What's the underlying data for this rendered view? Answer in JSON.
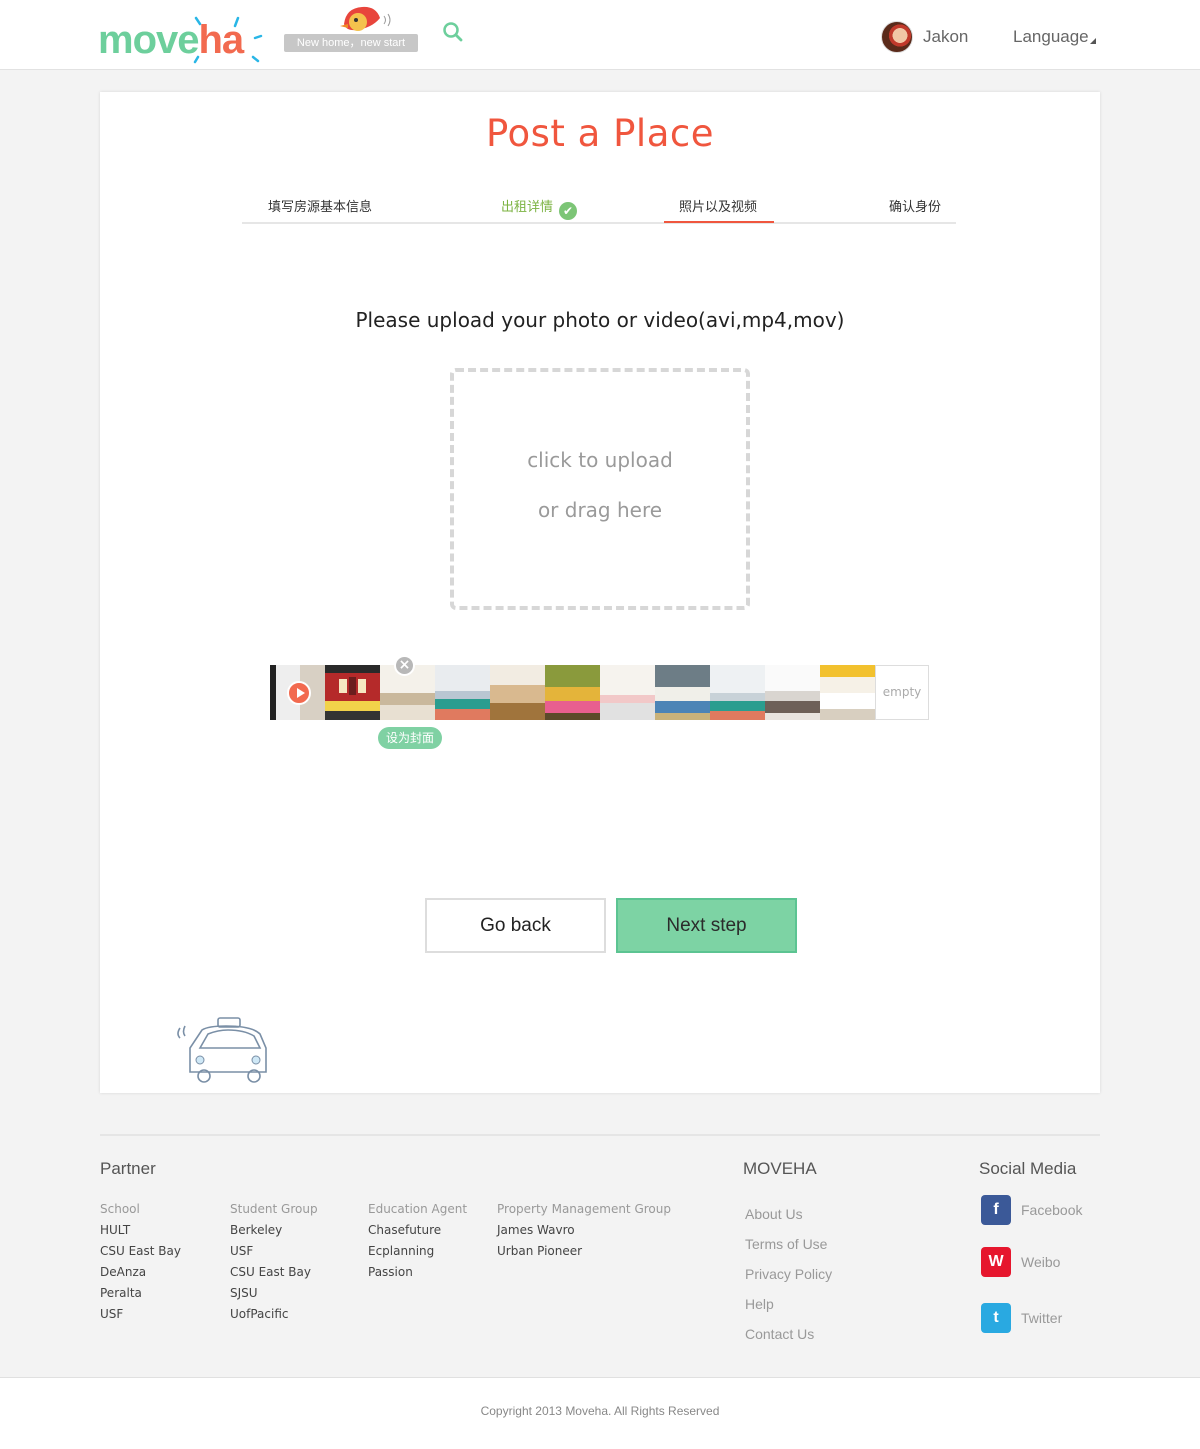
{
  "header": {
    "logo": {
      "part1": "move",
      "part2": "ha"
    },
    "tagline": "New home，new start",
    "user_name": "Jakon",
    "language_label": "Language"
  },
  "main": {
    "title": "Post  a Place",
    "steps": [
      {
        "label": "填写房源基本信息",
        "state": "pending"
      },
      {
        "label": "出租详情",
        "state": "done"
      },
      {
        "label": "照片以及视频",
        "state": "active"
      },
      {
        "label": "确认身份",
        "state": "pending"
      }
    ],
    "upload_prompt": "Please upload your photo or video(avi,mp4,mov)",
    "dropzone": {
      "line1": "click to upload",
      "line2": "or drag here"
    },
    "thumbnails": {
      "items": [
        {
          "kind": "video"
        },
        {
          "kind": "photo"
        },
        {
          "kind": "photo"
        },
        {
          "kind": "photo"
        },
        {
          "kind": "photo"
        },
        {
          "kind": "photo"
        },
        {
          "kind": "photo"
        },
        {
          "kind": "photo"
        },
        {
          "kind": "photo"
        },
        {
          "kind": "photo"
        },
        {
          "kind": "photo"
        }
      ],
      "empty_label": "empty",
      "set_cover_label": "设为封面",
      "remove_symbol": "×"
    },
    "buttons": {
      "back": "Go back",
      "next": "Next  step"
    }
  },
  "footer": {
    "partner_heading": "Partner",
    "partner_columns": [
      {
        "caption": "School",
        "items": [
          "HULT",
          "CSU East Bay",
          "DeAnza",
          "Peralta",
          "USF"
        ]
      },
      {
        "caption": "Student Group",
        "items": [
          "Berkeley",
          "USF",
          "CSU East Bay",
          "SJSU",
          "UofPacific"
        ]
      },
      {
        "caption": "Education Agent",
        "items": [
          "Chasefuture",
          "Ecplanning",
          "Passion"
        ]
      },
      {
        "caption": "Property Management Group",
        "items": [
          "James Wavro",
          "Urban Pioneer"
        ]
      }
    ],
    "moveha_heading": "MOVEHA",
    "moveha_links": [
      "About Us",
      "Terms of Use",
      "Privacy Policy",
      "Help",
      "Contact Us"
    ],
    "social_heading": "Social Media",
    "social": [
      {
        "label": "Facebook",
        "glyph": "f",
        "color": "#3b5998"
      },
      {
        "label": "Weibo",
        "glyph": "W",
        "color": "#e6162d"
      },
      {
        "label": "Twitter",
        "glyph": "t",
        "color": "#29a9e1"
      }
    ],
    "copyright": "Copyright 2013 Moveha.  All Rights Reserved"
  },
  "colors": {
    "accent": "#f0563e",
    "green": "#7dd3a4",
    "done_green": "#7cb342"
  }
}
